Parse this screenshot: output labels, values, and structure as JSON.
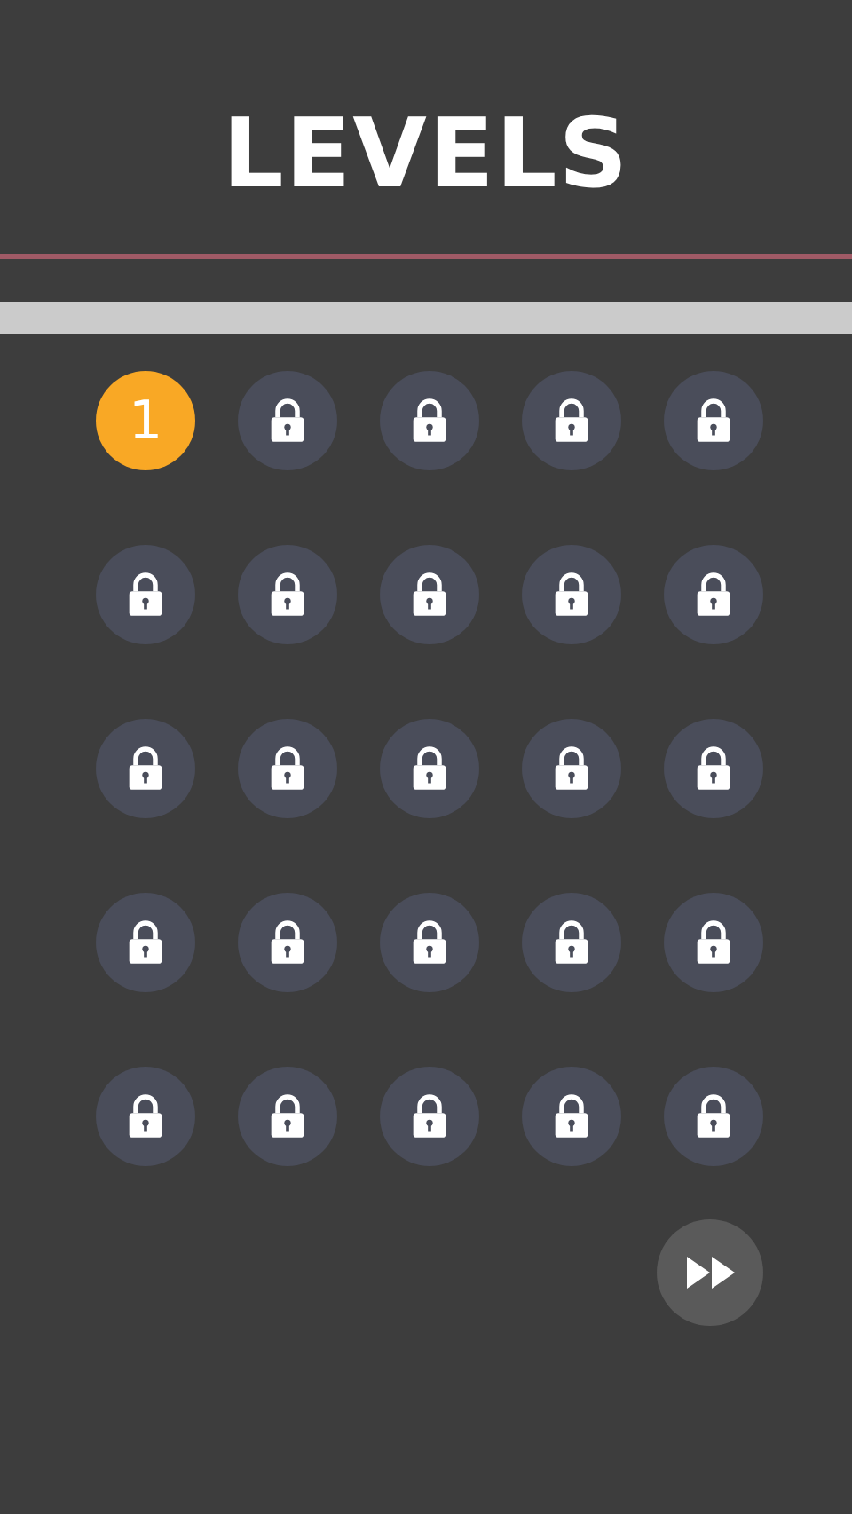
{
  "title": "LEVELS",
  "levels": [
    {
      "locked": false,
      "label": "1"
    },
    {
      "locked": true
    },
    {
      "locked": true
    },
    {
      "locked": true
    },
    {
      "locked": true
    },
    {
      "locked": true
    },
    {
      "locked": true
    },
    {
      "locked": true
    },
    {
      "locked": true
    },
    {
      "locked": true
    },
    {
      "locked": true
    },
    {
      "locked": true
    },
    {
      "locked": true
    },
    {
      "locked": true
    },
    {
      "locked": true
    },
    {
      "locked": true
    },
    {
      "locked": true
    },
    {
      "locked": true
    },
    {
      "locked": true
    },
    {
      "locked": true
    },
    {
      "locked": true
    },
    {
      "locked": true
    },
    {
      "locked": true
    },
    {
      "locked": true
    },
    {
      "locked": true
    }
  ]
}
